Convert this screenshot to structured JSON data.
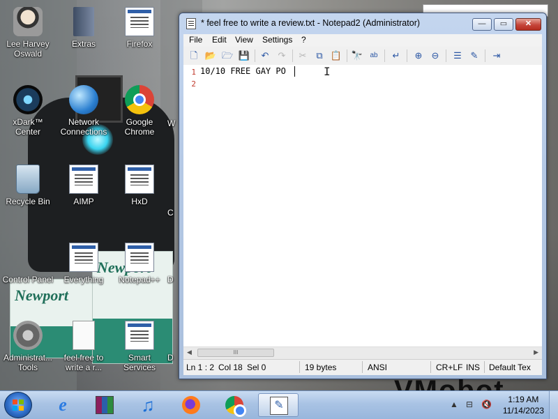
{
  "desktop": {
    "icons": [
      {
        "name": "desktop-icon-lee-harvey-oswald",
        "label": "Lee Harvey Oswald",
        "glyph": "👤"
      },
      {
        "name": "desktop-icon-extras",
        "label": "Extras",
        "glyph": "📁"
      },
      {
        "name": "desktop-icon-firefox",
        "label": "Firefox",
        "glyph": ""
      },
      {
        "name": "desktop-icon-xdark-center",
        "label": "xDark™ Center",
        "glyph": "◉"
      },
      {
        "name": "desktop-icon-network-connections",
        "label": "Network Connections",
        "glyph": "🌐"
      },
      {
        "name": "desktop-icon-google-chrome",
        "label": "Google Chrome",
        "glyph": ""
      },
      {
        "name": "desktop-icon-recycle-bin",
        "label": "Recycle Bin",
        "glyph": "🗑"
      },
      {
        "name": "desktop-icon-aimp",
        "label": "AIMP",
        "glyph": ""
      },
      {
        "name": "desktop-icon-hxd",
        "label": "HxD",
        "glyph": ""
      },
      {
        "name": "desktop-icon-control-panel",
        "label": "Control Panel",
        "glyph": ""
      },
      {
        "name": "desktop-icon-everything",
        "label": "Everything",
        "glyph": ""
      },
      {
        "name": "desktop-icon-notepad-plus-plus",
        "label": "Notepad++",
        "glyph": ""
      },
      {
        "name": "desktop-icon-administrative-tools",
        "label": "Administrat... Tools",
        "glyph": "⚙"
      },
      {
        "name": "desktop-icon-feel-free-review",
        "label": "feel free to write a r...",
        "glyph": ""
      },
      {
        "name": "desktop-icon-smart-services",
        "label": "Smart Services",
        "glyph": ""
      }
    ],
    "partial_labels": {
      "w": "W",
      "c": "C",
      "d1": "D",
      "d2": "D"
    },
    "wallpaper_text": "VMobot",
    "carton_brand": "Newport"
  },
  "notepad": {
    "title": "* feel free to write a review.txt - Notepad2 (Administrator)",
    "controls": {
      "minimize": "—",
      "maximize": "▭",
      "close": "✕"
    },
    "menu": [
      "File",
      "Edit",
      "View",
      "Settings",
      "?"
    ],
    "toolbar_icons": [
      {
        "name": "new-file-icon",
        "glyph": "🗋",
        "disabled": false
      },
      {
        "name": "open-folder-icon",
        "glyph": "📂",
        "disabled": false
      },
      {
        "name": "browse-icon",
        "glyph": "🗁",
        "disabled": false
      },
      {
        "name": "save-icon",
        "glyph": "💾",
        "disabled": false
      },
      {
        "name": "undo-icon",
        "glyph": "↶",
        "disabled": false
      },
      {
        "name": "redo-icon",
        "glyph": "↷",
        "disabled": true
      },
      {
        "name": "cut-icon",
        "glyph": "✂",
        "disabled": true
      },
      {
        "name": "copy-icon",
        "glyph": "⧉",
        "disabled": false
      },
      {
        "name": "paste-icon",
        "glyph": "📋",
        "disabled": true
      },
      {
        "name": "find-icon",
        "glyph": "🔭",
        "disabled": false
      },
      {
        "name": "replace-icon",
        "glyph": "ab",
        "disabled": false
      },
      {
        "name": "word-wrap-icon",
        "glyph": "↵",
        "disabled": false
      },
      {
        "name": "zoom-in-icon",
        "glyph": "⊕",
        "disabled": false
      },
      {
        "name": "zoom-out-icon",
        "glyph": "⊖",
        "disabled": false
      },
      {
        "name": "scheme-icon",
        "glyph": "☰",
        "disabled": false
      },
      {
        "name": "customize-icon",
        "glyph": "✎",
        "disabled": false
      },
      {
        "name": "exit-icon",
        "glyph": "⇥",
        "disabled": false
      }
    ],
    "lines": [
      {
        "number": "1",
        "text": "10/10 FREE GAY PO"
      },
      {
        "number": "2",
        "text": ""
      }
    ],
    "scroll_thumb_glyph": "III",
    "status": {
      "position": "Ln 1 : 2",
      "column": "Col 18",
      "selection": "Sel 0",
      "size": "19 bytes",
      "encoding": "ANSI",
      "line_endings": "CR+LF",
      "insert_mode": "INS",
      "scheme": "Default Tex"
    }
  },
  "taskbar": {
    "pinned": [
      {
        "name": "taskbar-internet-explorer",
        "glyph": "e"
      },
      {
        "name": "taskbar-winrar",
        "glyph": "▦"
      },
      {
        "name": "taskbar-itunes",
        "glyph": "♫"
      },
      {
        "name": "taskbar-firefox",
        "glyph": ""
      },
      {
        "name": "taskbar-chrome",
        "glyph": ""
      },
      {
        "name": "taskbar-notepad2",
        "glyph": "✎"
      }
    ],
    "tray": {
      "chevron": "▲",
      "network": "⊟",
      "volume": "🔇",
      "time": "1:19 AM",
      "date": "11/14/2023"
    }
  },
  "colors": {
    "accent": "#2f5fa8",
    "close": "#c5453a",
    "line_number": "#c0392b"
  }
}
